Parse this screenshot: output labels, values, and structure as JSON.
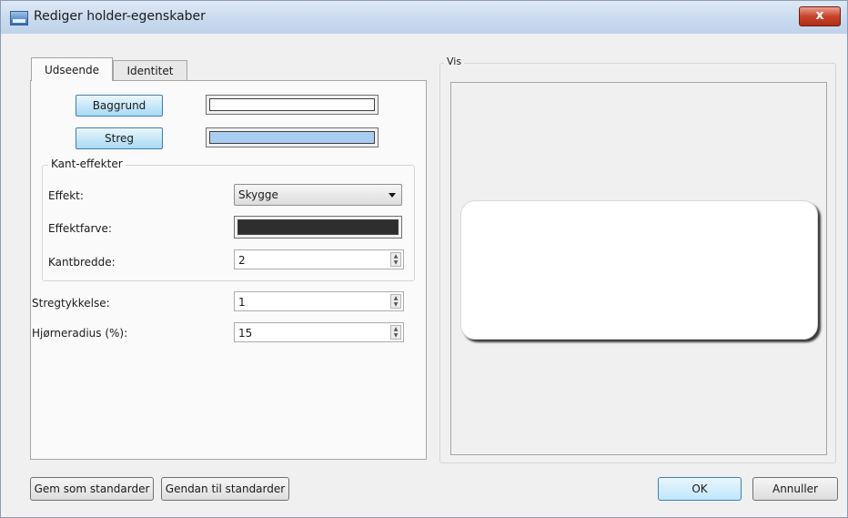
{
  "window": {
    "title": "Rediger holder-egenskaber",
    "close_glyph": "x",
    "app_icon": "window-icon"
  },
  "tabs": [
    {
      "label": "Udseende"
    },
    {
      "label": "Identitet"
    }
  ],
  "appearance": {
    "background_button": "Baggrund",
    "stroke_button": "Streg",
    "background_color": "#ffffff",
    "stroke_color": "#a9cdf1",
    "edge_effects": {
      "title": "Kant-effekter",
      "effect_label": "Effekt:",
      "effect_value": "Skygge",
      "effect_color_label": "Effektfarve:",
      "effect_color": "#2e2e2e",
      "edge_width_label": "Kantbredde:",
      "edge_width_value": "2"
    },
    "stroke_thickness_label": "Stregtykkelse:",
    "stroke_thickness_value": "1",
    "corner_radius_label": "Hjørneradius (%):",
    "corner_radius_value": "15"
  },
  "preview": {
    "title": "Vis"
  },
  "footer": {
    "save_default": "Gem som standarder",
    "reset_default": "Gendan til standarder",
    "ok": "OK",
    "cancel": "Annuller"
  }
}
